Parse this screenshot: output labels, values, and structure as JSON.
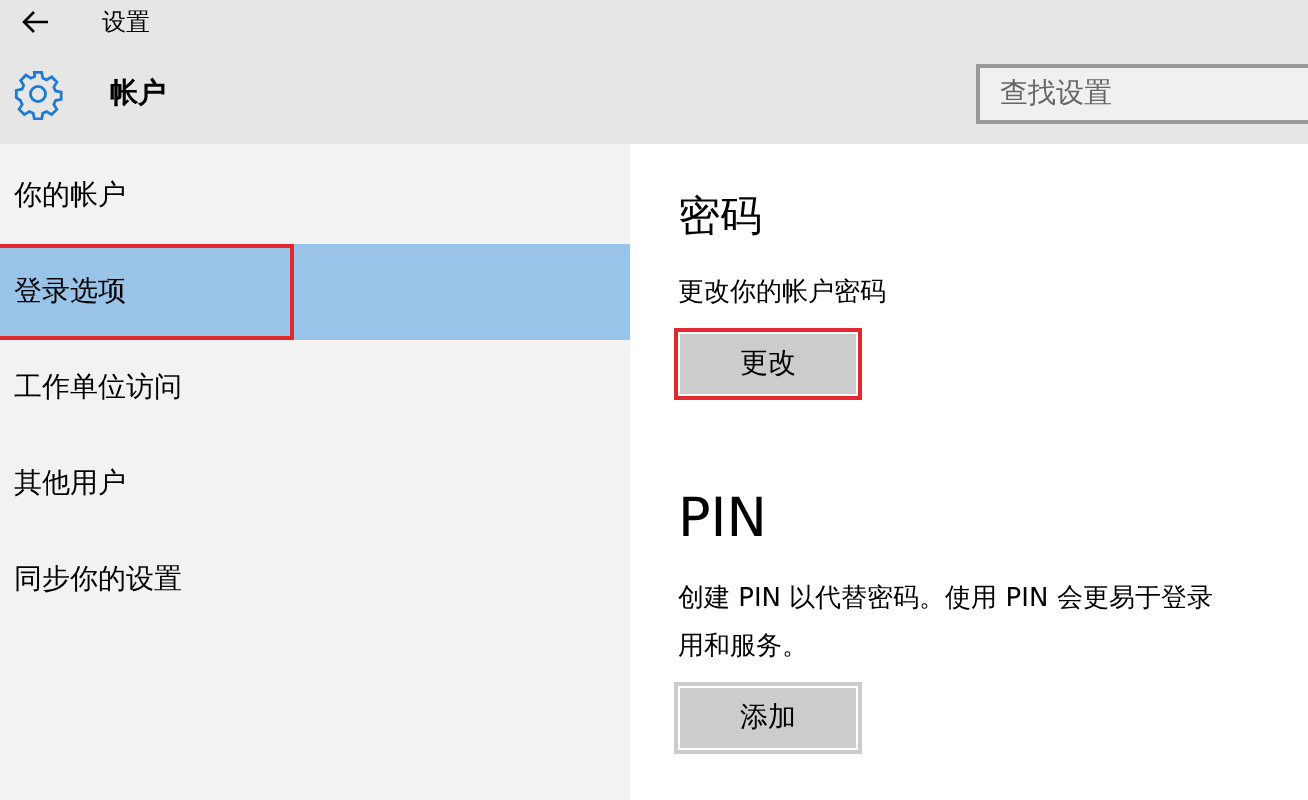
{
  "window": {
    "title": "设置"
  },
  "header": {
    "title": "帐户",
    "search": {
      "placeholder": "查找设置"
    }
  },
  "sidebar": {
    "items": [
      {
        "label": "你的帐户",
        "selected": false,
        "annotated": false
      },
      {
        "label": "登录选项",
        "selected": true,
        "annotated": true
      },
      {
        "label": "工作单位访问",
        "selected": false,
        "annotated": false
      },
      {
        "label": "其他用户",
        "selected": false,
        "annotated": false
      },
      {
        "label": "同步你的设置",
        "selected": false,
        "annotated": false
      }
    ]
  },
  "sections": [
    {
      "heading": "密码",
      "description": [
        "更改你的帐户密码"
      ],
      "button": {
        "label": "更改",
        "annotated": true
      }
    },
    {
      "heading": "PIN",
      "description": [
        "创建 PIN 以代替密码。使用 PIN 会更易于登录",
        "用和服务。"
      ],
      "button": {
        "label": "添加",
        "annotated": false
      }
    }
  ]
}
